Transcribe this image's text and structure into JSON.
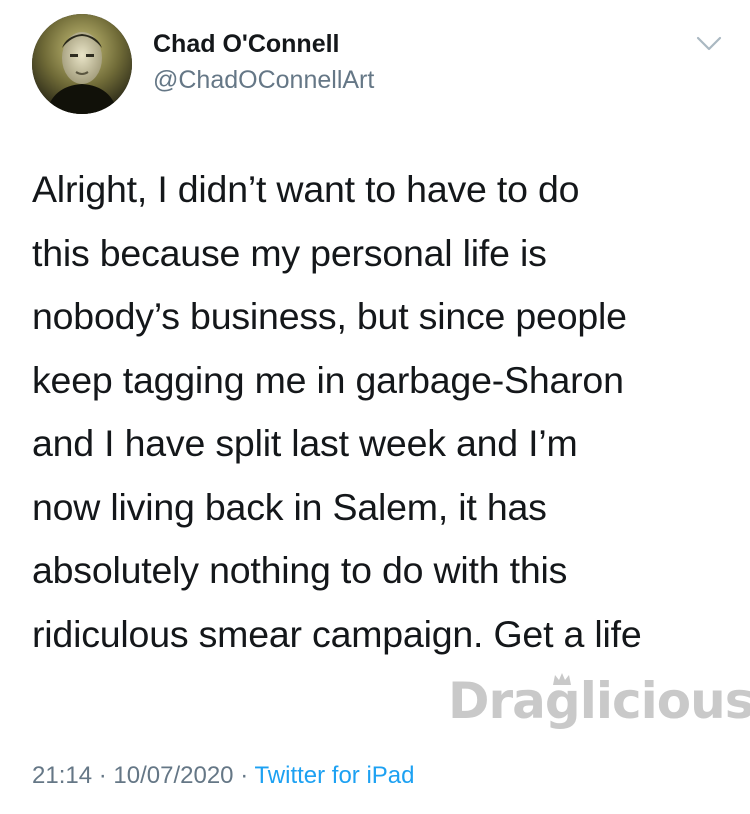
{
  "tweet": {
    "author_name": "Chad O'Connell",
    "author_handle": "@ChadOConnellArt",
    "text": "Alright, I didn’t want to have to do\nthis because my personal life is\nnobody’s business, but since people\nkeep tagging me in garbage-Sharon\nand I have split last week and I’m\nnow living back in Salem, it has\nabsolutely nothing to do with this\nridiculous smear campaign. Get a life",
    "time": "21:14",
    "separator_1": "·",
    "date": "10/07/2020",
    "separator_2": "·",
    "source": "Twitter for iPad"
  },
  "watermark": {
    "text": "Draglicious"
  },
  "icons": {
    "caret": "chevron-down-icon",
    "watermark_crown": "crown-icon"
  },
  "colors": {
    "text_primary": "#14171a",
    "text_secondary": "#657786",
    "link": "#1da1f2",
    "watermark": "#c9c9c9",
    "caret": "#aab8c2"
  }
}
